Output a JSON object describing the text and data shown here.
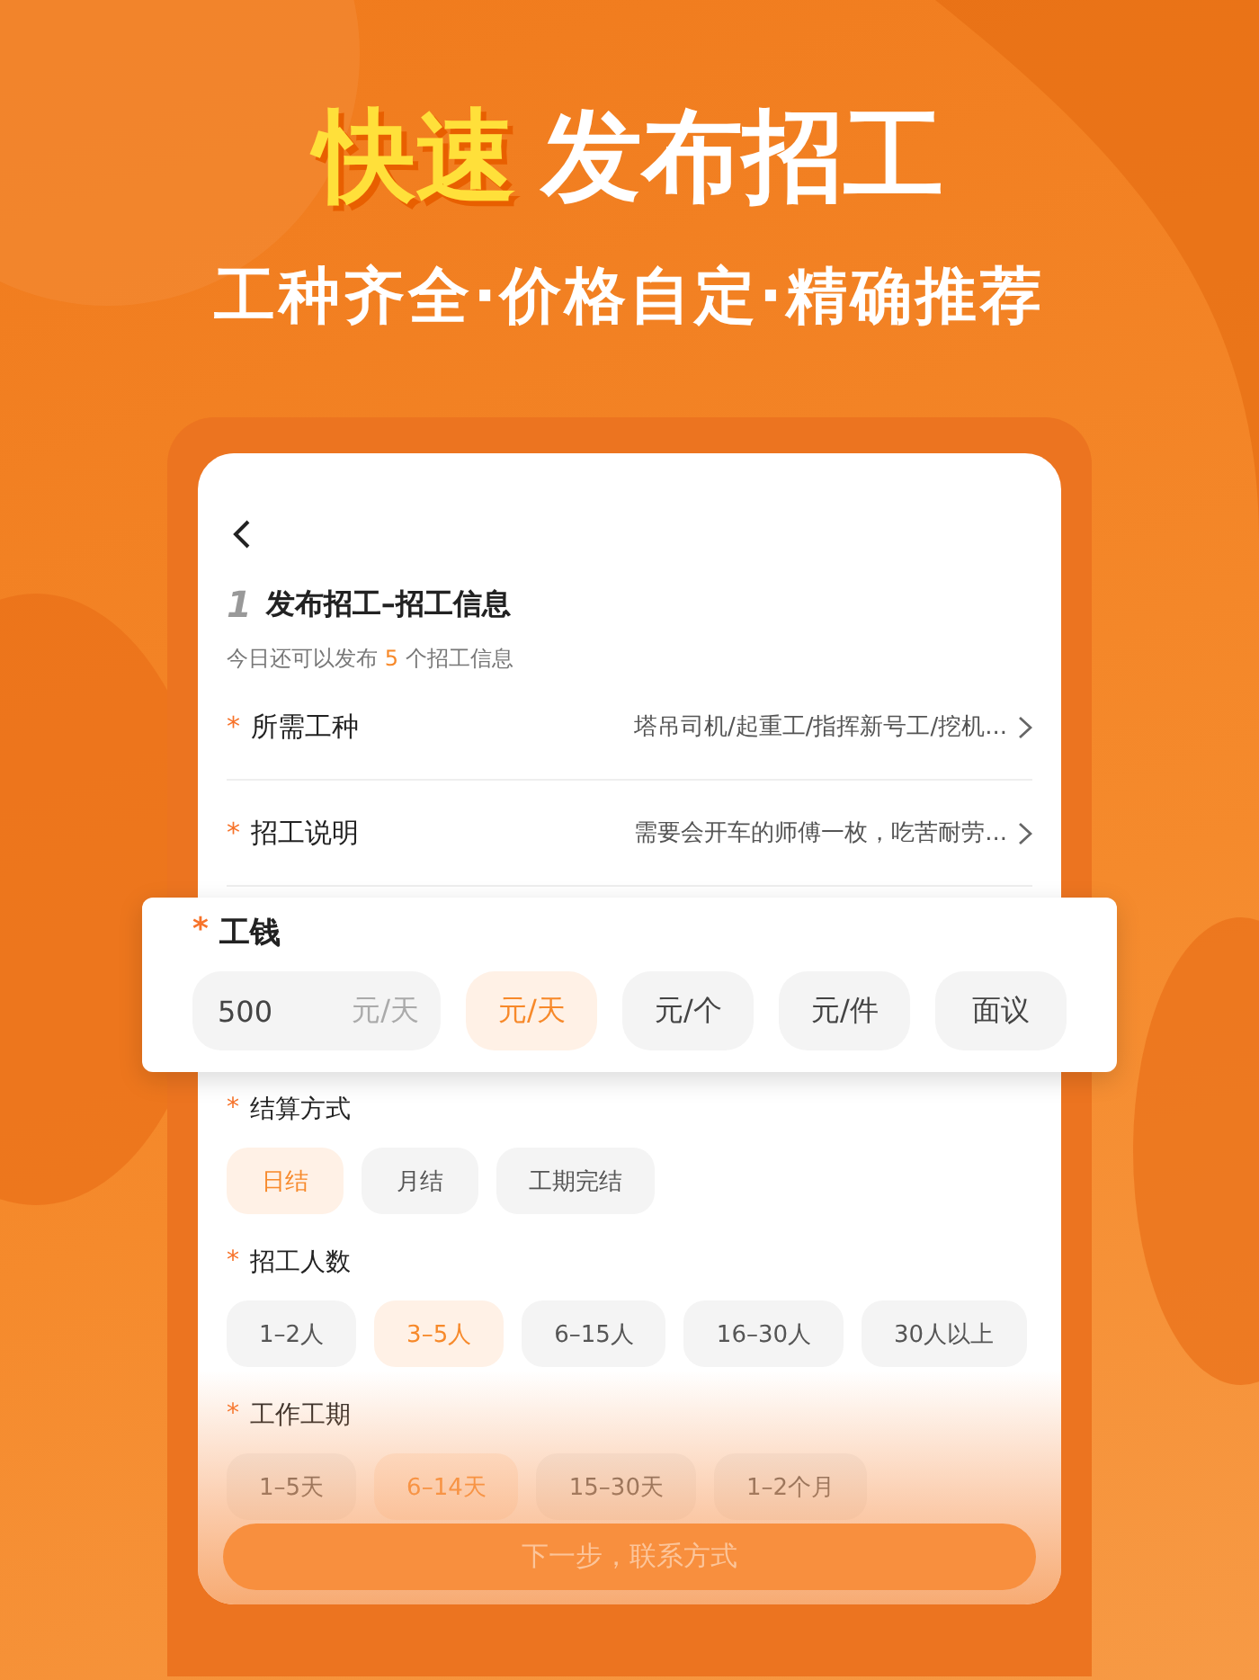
{
  "headline": {
    "highlight": "快速",
    "rest": "发布招工"
  },
  "subtitle": "工种齐全·价格自定·精确推荐",
  "form": {
    "step": "1",
    "title": "发布招工–招工信息",
    "quota": {
      "before": "今日还可以发布",
      "count": "5",
      "after": "个招工信息"
    },
    "rows": [
      {
        "mark": "*",
        "label": "所需工种",
        "value": "塔吊司机/起重工/指挥新号工/挖机..."
      },
      {
        "mark": "*",
        "label": "招工说明",
        "value": "需要会开车的师傅一枚，吃苦耐劳..."
      }
    ],
    "wage": {
      "mark": "*",
      "label": "工钱",
      "value": "500",
      "unit": "元/天",
      "options": [
        {
          "label": "元/天",
          "selected": true
        },
        {
          "label": "元/个",
          "selected": false
        },
        {
          "label": "元/件",
          "selected": false
        },
        {
          "label": "面议",
          "selected": false
        }
      ]
    },
    "groups": [
      {
        "mark": "*",
        "label": "结算方式",
        "options": [
          {
            "label": "日结",
            "selected": true
          },
          {
            "label": "月结",
            "selected": false
          },
          {
            "label": "工期完结",
            "selected": false
          }
        ]
      },
      {
        "mark": "*",
        "label": "招工人数",
        "options": [
          {
            "label": "1–2人",
            "selected": false
          },
          {
            "label": "3–5人",
            "selected": true
          },
          {
            "label": "6–15人",
            "selected": false
          },
          {
            "label": "16–30人",
            "selected": false
          },
          {
            "label": "30人以上",
            "selected": false
          }
        ]
      },
      {
        "mark": "*",
        "label": "工作工期",
        "options": [
          {
            "label": "1–5天",
            "selected": false
          },
          {
            "label": "6–14天",
            "selected": true
          },
          {
            "label": "15–30天",
            "selected": false
          },
          {
            "label": "1–2个月",
            "selected": false
          }
        ]
      }
    ],
    "next_button": "下一步，联系方式"
  }
}
